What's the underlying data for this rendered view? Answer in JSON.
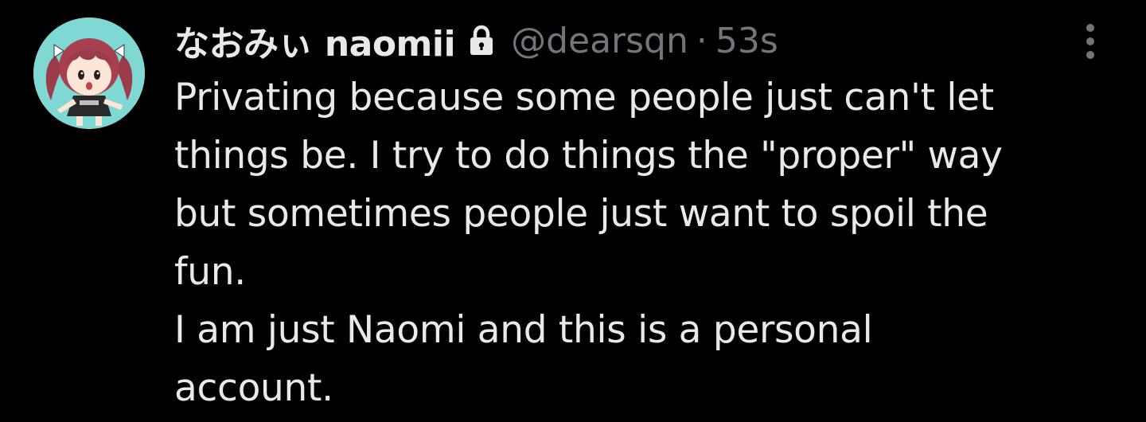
{
  "tweet": {
    "author": {
      "display_name": "なおみぃ naomii",
      "handle": "@dearsqn",
      "avatar_icon": "anime-girl-avatar",
      "protected_icon": "lock-icon"
    },
    "separator": "·",
    "timestamp": "53s",
    "more_icon": "more-vertical-icon",
    "text_lines": [
      "Privating because some people just can't let",
      "things be. I try to do things the \"proper\" way",
      "but sometimes people just want to spoil the",
      "fun.",
      "I am just Naomi and this is a personal",
      "account."
    ]
  },
  "colors": {
    "background": "#000000",
    "primary_text": "#e7e9ea",
    "secondary_text": "#71767b",
    "avatar_background": "#7fd8d4"
  }
}
